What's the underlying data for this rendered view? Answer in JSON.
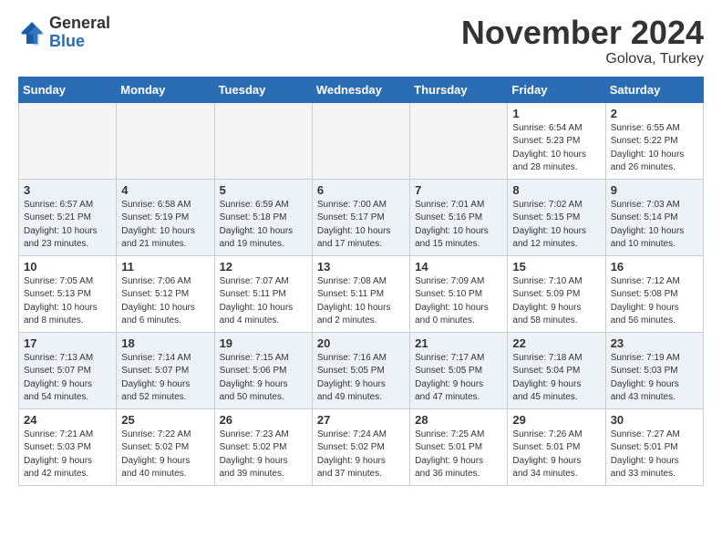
{
  "header": {
    "logo_general": "General",
    "logo_blue": "Blue",
    "month_title": "November 2024",
    "location": "Golova, Turkey"
  },
  "days_of_week": [
    "Sunday",
    "Monday",
    "Tuesday",
    "Wednesday",
    "Thursday",
    "Friday",
    "Saturday"
  ],
  "weeks": [
    [
      {
        "day": "",
        "info": ""
      },
      {
        "day": "",
        "info": ""
      },
      {
        "day": "",
        "info": ""
      },
      {
        "day": "",
        "info": ""
      },
      {
        "day": "",
        "info": ""
      },
      {
        "day": "1",
        "info": "Sunrise: 6:54 AM\nSunset: 5:23 PM\nDaylight: 10 hours\nand 28 minutes."
      },
      {
        "day": "2",
        "info": "Sunrise: 6:55 AM\nSunset: 5:22 PM\nDaylight: 10 hours\nand 26 minutes."
      }
    ],
    [
      {
        "day": "3",
        "info": "Sunrise: 6:57 AM\nSunset: 5:21 PM\nDaylight: 10 hours\nand 23 minutes."
      },
      {
        "day": "4",
        "info": "Sunrise: 6:58 AM\nSunset: 5:19 PM\nDaylight: 10 hours\nand 21 minutes."
      },
      {
        "day": "5",
        "info": "Sunrise: 6:59 AM\nSunset: 5:18 PM\nDaylight: 10 hours\nand 19 minutes."
      },
      {
        "day": "6",
        "info": "Sunrise: 7:00 AM\nSunset: 5:17 PM\nDaylight: 10 hours\nand 17 minutes."
      },
      {
        "day": "7",
        "info": "Sunrise: 7:01 AM\nSunset: 5:16 PM\nDaylight: 10 hours\nand 15 minutes."
      },
      {
        "day": "8",
        "info": "Sunrise: 7:02 AM\nSunset: 5:15 PM\nDaylight: 10 hours\nand 12 minutes."
      },
      {
        "day": "9",
        "info": "Sunrise: 7:03 AM\nSunset: 5:14 PM\nDaylight: 10 hours\nand 10 minutes."
      }
    ],
    [
      {
        "day": "10",
        "info": "Sunrise: 7:05 AM\nSunset: 5:13 PM\nDaylight: 10 hours\nand 8 minutes."
      },
      {
        "day": "11",
        "info": "Sunrise: 7:06 AM\nSunset: 5:12 PM\nDaylight: 10 hours\nand 6 minutes."
      },
      {
        "day": "12",
        "info": "Sunrise: 7:07 AM\nSunset: 5:11 PM\nDaylight: 10 hours\nand 4 minutes."
      },
      {
        "day": "13",
        "info": "Sunrise: 7:08 AM\nSunset: 5:11 PM\nDaylight: 10 hours\nand 2 minutes."
      },
      {
        "day": "14",
        "info": "Sunrise: 7:09 AM\nSunset: 5:10 PM\nDaylight: 10 hours\nand 0 minutes."
      },
      {
        "day": "15",
        "info": "Sunrise: 7:10 AM\nSunset: 5:09 PM\nDaylight: 9 hours\nand 58 minutes."
      },
      {
        "day": "16",
        "info": "Sunrise: 7:12 AM\nSunset: 5:08 PM\nDaylight: 9 hours\nand 56 minutes."
      }
    ],
    [
      {
        "day": "17",
        "info": "Sunrise: 7:13 AM\nSunset: 5:07 PM\nDaylight: 9 hours\nand 54 minutes."
      },
      {
        "day": "18",
        "info": "Sunrise: 7:14 AM\nSunset: 5:07 PM\nDaylight: 9 hours\nand 52 minutes."
      },
      {
        "day": "19",
        "info": "Sunrise: 7:15 AM\nSunset: 5:06 PM\nDaylight: 9 hours\nand 50 minutes."
      },
      {
        "day": "20",
        "info": "Sunrise: 7:16 AM\nSunset: 5:05 PM\nDaylight: 9 hours\nand 49 minutes."
      },
      {
        "day": "21",
        "info": "Sunrise: 7:17 AM\nSunset: 5:05 PM\nDaylight: 9 hours\nand 47 minutes."
      },
      {
        "day": "22",
        "info": "Sunrise: 7:18 AM\nSunset: 5:04 PM\nDaylight: 9 hours\nand 45 minutes."
      },
      {
        "day": "23",
        "info": "Sunrise: 7:19 AM\nSunset: 5:03 PM\nDaylight: 9 hours\nand 43 minutes."
      }
    ],
    [
      {
        "day": "24",
        "info": "Sunrise: 7:21 AM\nSunset: 5:03 PM\nDaylight: 9 hours\nand 42 minutes."
      },
      {
        "day": "25",
        "info": "Sunrise: 7:22 AM\nSunset: 5:02 PM\nDaylight: 9 hours\nand 40 minutes."
      },
      {
        "day": "26",
        "info": "Sunrise: 7:23 AM\nSunset: 5:02 PM\nDaylight: 9 hours\nand 39 minutes."
      },
      {
        "day": "27",
        "info": "Sunrise: 7:24 AM\nSunset: 5:02 PM\nDaylight: 9 hours\nand 37 minutes."
      },
      {
        "day": "28",
        "info": "Sunrise: 7:25 AM\nSunset: 5:01 PM\nDaylight: 9 hours\nand 36 minutes."
      },
      {
        "day": "29",
        "info": "Sunrise: 7:26 AM\nSunset: 5:01 PM\nDaylight: 9 hours\nand 34 minutes."
      },
      {
        "day": "30",
        "info": "Sunrise: 7:27 AM\nSunset: 5:01 PM\nDaylight: 9 hours\nand 33 minutes."
      }
    ]
  ],
  "colors": {
    "header_bg": "#2a6db5",
    "logo_blue": "#2a6db5",
    "week_even_bg": "#edf2f9",
    "week_odd_bg": "#ffffff"
  }
}
